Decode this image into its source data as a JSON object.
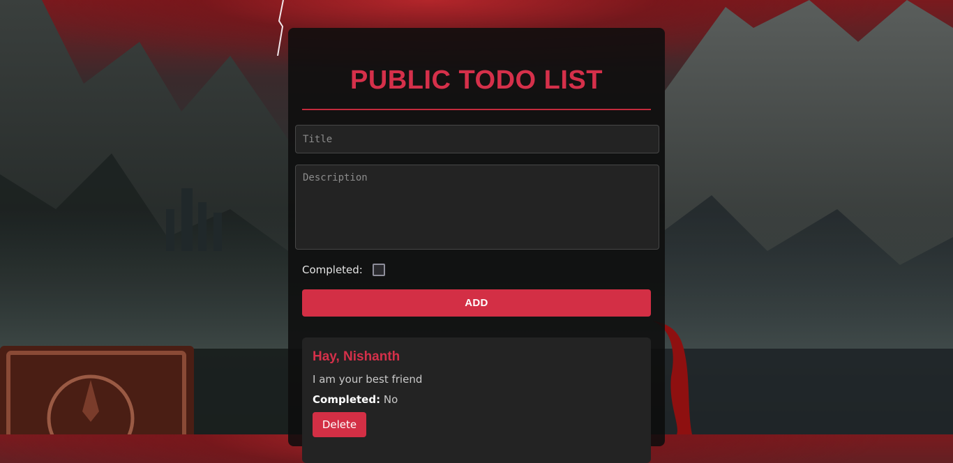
{
  "page": {
    "heading": "PUBLIC TODO LIST"
  },
  "form": {
    "title_placeholder": "Title",
    "description_placeholder": "Description",
    "completed_label": "Completed:",
    "completed_checked": false,
    "add_label": "ADD"
  },
  "todos": [
    {
      "title": "Hay, Nishanth",
      "description": "I am your best friend",
      "completed_label": "Completed:",
      "completed_value": "No",
      "delete_label": "Delete"
    }
  ],
  "colors": {
    "accent": "#d32f45",
    "panel": "#0e0e0e",
    "card": "#232323"
  },
  "icons": {
    "completed_checkbox": "checkbox-unchecked-icon"
  }
}
